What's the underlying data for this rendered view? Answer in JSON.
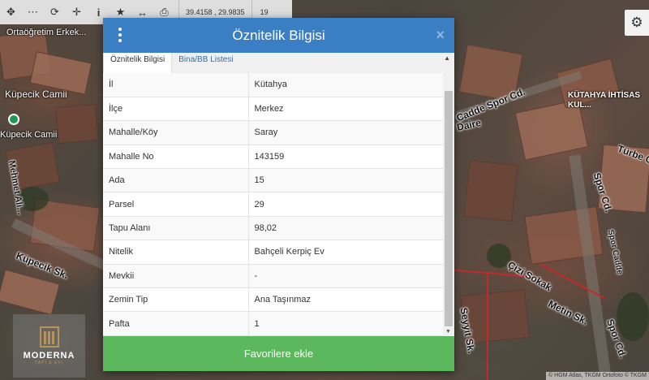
{
  "toolbar": {
    "icons": [
      "move-icon",
      "measure-icon",
      "refresh-icon",
      "locate-icon",
      "info-icon",
      "star-icon",
      "swap-icon",
      "print-icon"
    ],
    "coords": "39.4158 , 29.9835",
    "zoom": "19"
  },
  "map": {
    "labels": {
      "poi_top": "Ortaöğretim Erkek...",
      "poi_cami": "Küpecik Camii",
      "poi_cami2": "Küpecik Camii",
      "street_1": "Küpecik Sk.",
      "street_2": "Mehmet Ali...",
      "street_3": "Cadde Spor Cd.",
      "street_4": "Daire",
      "street_5": "Türbe C...",
      "street_6": "Spor Cd.",
      "street_7": "Spor Cadde",
      "street_8": "Çizi Sokak",
      "street_9": "Metin Sk.",
      "street_10": "Spor Cd.",
      "street_11": "Seyyit Sk.",
      "hospital": "KÜTAHYA İHTİSAS KUL...",
      "attribution": "© HGM Atlas, TKGM Ortofoto © TKGM"
    }
  },
  "logo": {
    "name": "MODERNA",
    "sub": "YAPI & EVİ"
  },
  "modal": {
    "title": "Öznitelik Bilgisi",
    "close": "×",
    "tabs": [
      {
        "label": "Öznitelik Bilgisi",
        "active": true
      },
      {
        "label": "Bina/BB Listesi",
        "active": false
      }
    ],
    "rows": [
      {
        "key": "İl",
        "value": "Kütahya"
      },
      {
        "key": "İlçe",
        "value": "Merkez"
      },
      {
        "key": "Mahalle/Köy",
        "value": "Saray"
      },
      {
        "key": "Mahalle No",
        "value": "143159"
      },
      {
        "key": "Ada",
        "value": "15"
      },
      {
        "key": "Parsel",
        "value": "29"
      },
      {
        "key": "Tapu Alanı",
        "value": "98,02"
      },
      {
        "key": "Nitelik",
        "value": "Bahçeli Kerpiç Ev"
      },
      {
        "key": "Mevkii",
        "value": "-"
      },
      {
        "key": "Zemin Tip",
        "value": "Ana Taşınmaz"
      },
      {
        "key": "Pafta",
        "value": "1"
      }
    ],
    "favorite_button": "Favorilere ekle"
  },
  "colors": {
    "header": "#3a7ec4",
    "button": "#5cb85c",
    "tab_link": "#2a6fb3",
    "parcel_line": "#c42a2a"
  }
}
